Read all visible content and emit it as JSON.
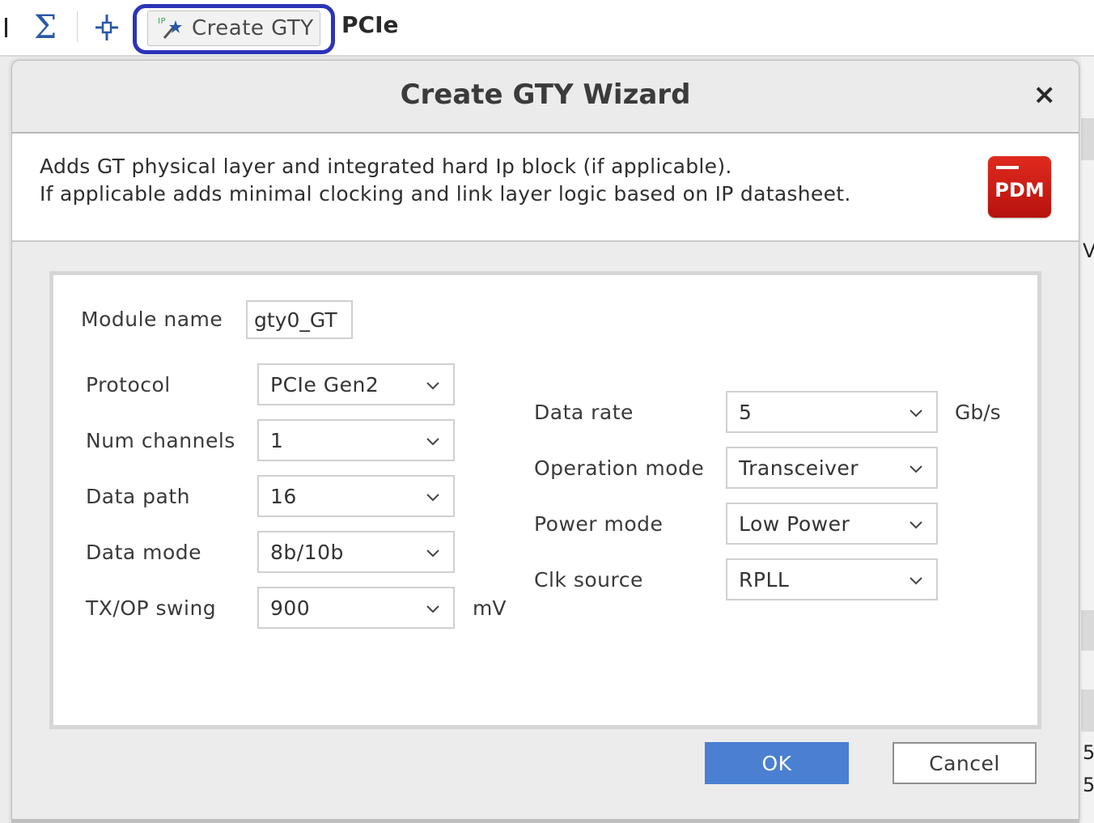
{
  "toolbar": {
    "sigma_glyph": "Σ",
    "create_gty_label": "Create GTY",
    "pcie_label": "PCIe",
    "ip_badge": "IP"
  },
  "background": {
    "right_texts": [
      "V",
      "5",
      "5"
    ]
  },
  "dialog": {
    "title": "Create GTY Wizard",
    "close_glyph": "×",
    "description": {
      "line1": "Adds GT physical layer and integrated hard Ip block (if applicable).",
      "line2": "If applicable adds minimal clocking and link layer logic based on IP datasheet."
    },
    "logo_text": "PDM",
    "module_name": {
      "label": "Module name",
      "value": "gty0_GT"
    },
    "left_fields": [
      {
        "label": "Protocol",
        "value": "PCIe Gen2"
      },
      {
        "label": "Num channels",
        "value": "1"
      },
      {
        "label": "Data path",
        "value": "16"
      },
      {
        "label": "Data mode",
        "value": "8b/10b"
      },
      {
        "label": "TX/OP swing",
        "value": "900",
        "unit": "mV"
      }
    ],
    "right_fields": [
      {
        "label": "Data rate",
        "value": "5",
        "unit": "Gb/s"
      },
      {
        "label": "Operation mode",
        "value": "Transceiver"
      },
      {
        "label": "Power mode",
        "value": "Low Power"
      },
      {
        "label": "Clk source",
        "value": "RPLL"
      }
    ],
    "buttons": {
      "ok": "OK",
      "cancel": "Cancel"
    }
  },
  "colors": {
    "accent_ok": "#4a7fd2",
    "highlight_ring": "#2c33b8",
    "logo_red": "#d01f17",
    "sigma_blue": "#2a58a8"
  }
}
